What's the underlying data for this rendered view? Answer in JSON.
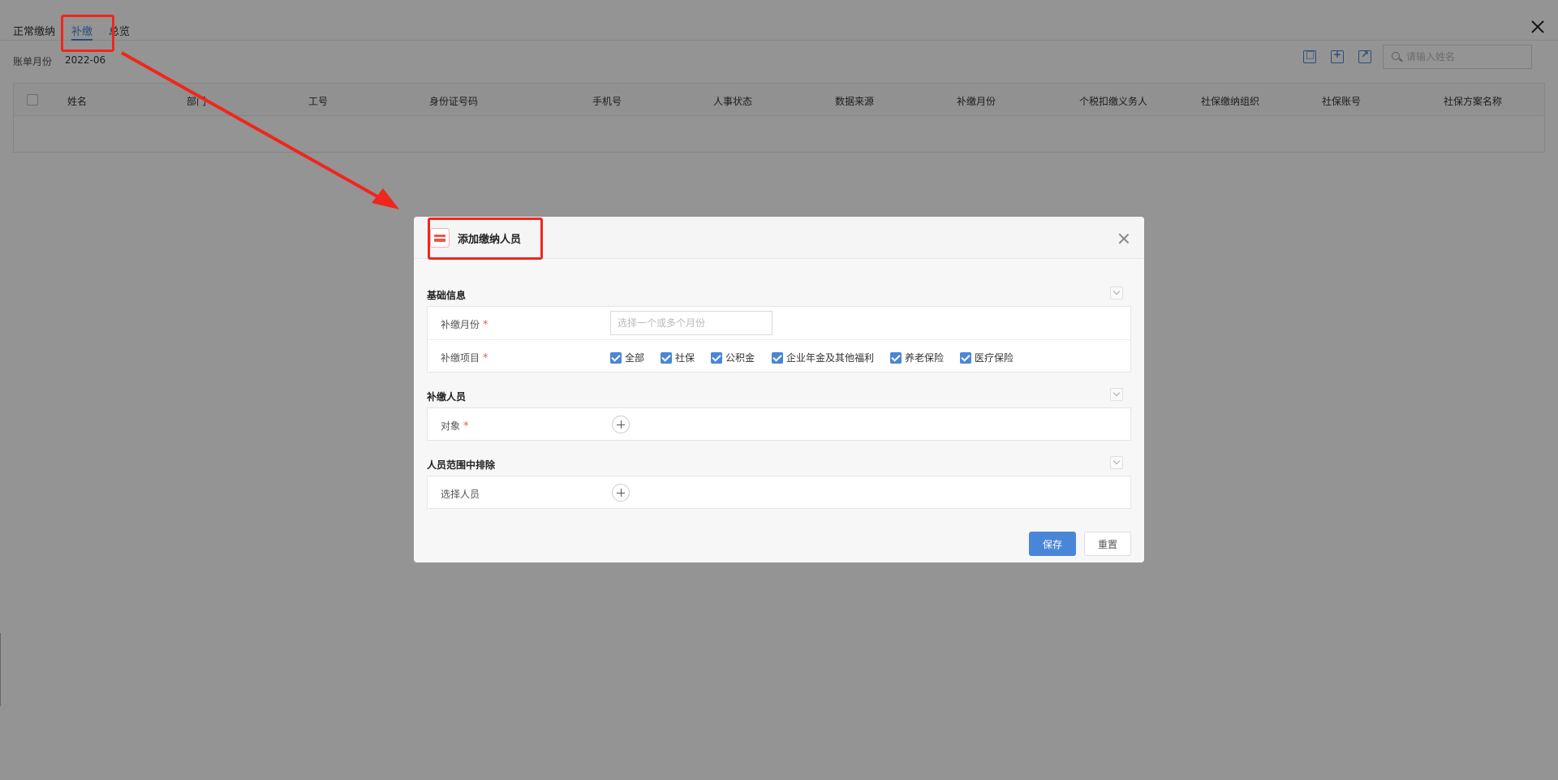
{
  "tabs": [
    {
      "label": "正常缴纳",
      "active": false
    },
    {
      "label": "补缴",
      "active": true
    },
    {
      "label": "总览",
      "active": false
    }
  ],
  "bill": {
    "label": "账单月份",
    "value": "2022-06"
  },
  "toolbar": {
    "icons": [
      "import-icon",
      "add-icon",
      "export-icon"
    ],
    "search_placeholder": "请输入姓名"
  },
  "table": {
    "columns": [
      "姓名",
      "部门",
      "工号",
      "身份证号码",
      "手机号",
      "人事状态",
      "数据来源",
      "补缴月份",
      "个税扣缴义务人",
      "社保缴纳组织",
      "社保账号",
      "社保方案名称"
    ],
    "rows": []
  },
  "modal": {
    "title": "添加缴纳人员",
    "icon": "card-icon",
    "sections": {
      "basic": {
        "title": "基础信息",
        "month_label": "补缴月份",
        "month_placeholder": "选择一个或多个月份",
        "items_label": "补缴项目",
        "checkboxes": [
          {
            "label": "全部",
            "checked": true
          },
          {
            "label": "社保",
            "checked": true
          },
          {
            "label": "公积金",
            "checked": true
          },
          {
            "label": "企业年金及其他福利",
            "checked": true
          },
          {
            "label": "养老保险",
            "checked": true
          },
          {
            "label": "医疗保险",
            "checked": true
          }
        ]
      },
      "persons": {
        "title": "补缴人员",
        "object_label": "对象"
      },
      "exclude": {
        "title": "人员范围中排除",
        "select_label": "选择人员"
      }
    },
    "save_label": "保存",
    "reset_label": "重置"
  },
  "colors": {
    "accent": "#4a86d8",
    "annotation": "#f0261c",
    "required": "#e8594f"
  }
}
